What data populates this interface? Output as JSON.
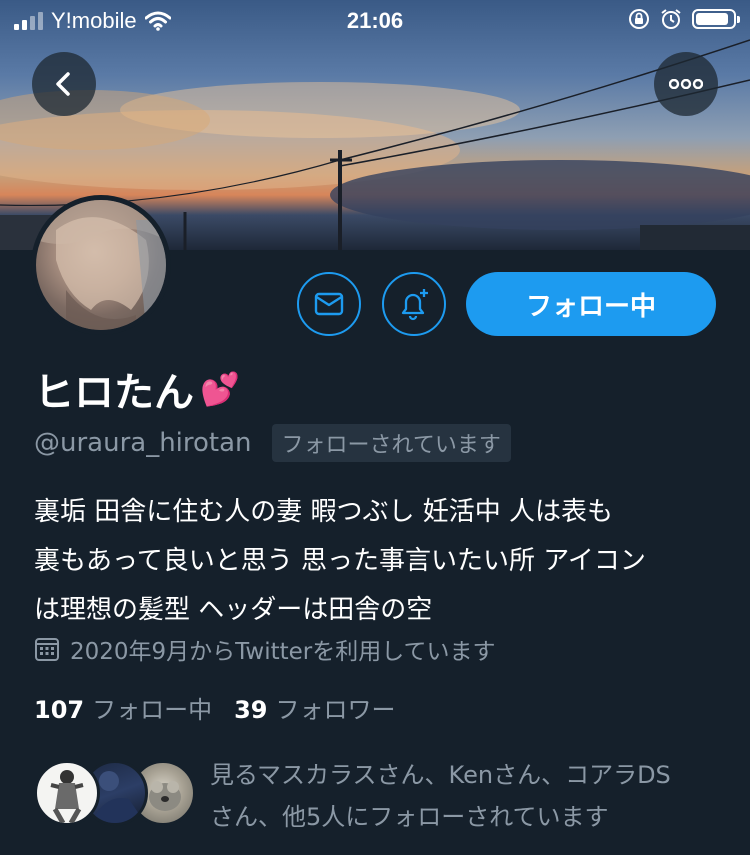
{
  "status_bar": {
    "carrier": "Y!mobile",
    "time": "21:06"
  },
  "header": {
    "back_icon": "chevron-left-icon",
    "more_icon": "more-horizontal-icon"
  },
  "actions": {
    "dm_icon": "mail-icon",
    "notify_icon": "bell-plus-icon",
    "follow_label": "フォロー中"
  },
  "profile": {
    "display_name": "ヒロたん",
    "name_emoji": "💕",
    "handle": "@uraura_hirotan",
    "follows_you": "フォローされています",
    "bio_lines": [
      "裏垢 田舎に住む人の妻 暇つぶし 妊活中 人は表も",
      "裏もあって良いと思う 思った事言いたい所 アイコン",
      "は理想の髪型 ヘッダーは田舎の空"
    ],
    "joined": "2020年9月からTwitterを利用しています"
  },
  "stats": {
    "following_count": "107",
    "following_label": "フォロー中",
    "followers_count": "39",
    "followers_label": "フォロワー"
  },
  "mutuals": {
    "text_lines": [
      "見るマスカラスさん、Kenさん、コアラDS",
      "さん、他5人にフォローされています"
    ]
  },
  "colors": {
    "background": "#15202b",
    "accent": "#1d9bf0",
    "secondary_text": "#8b98a5"
  }
}
